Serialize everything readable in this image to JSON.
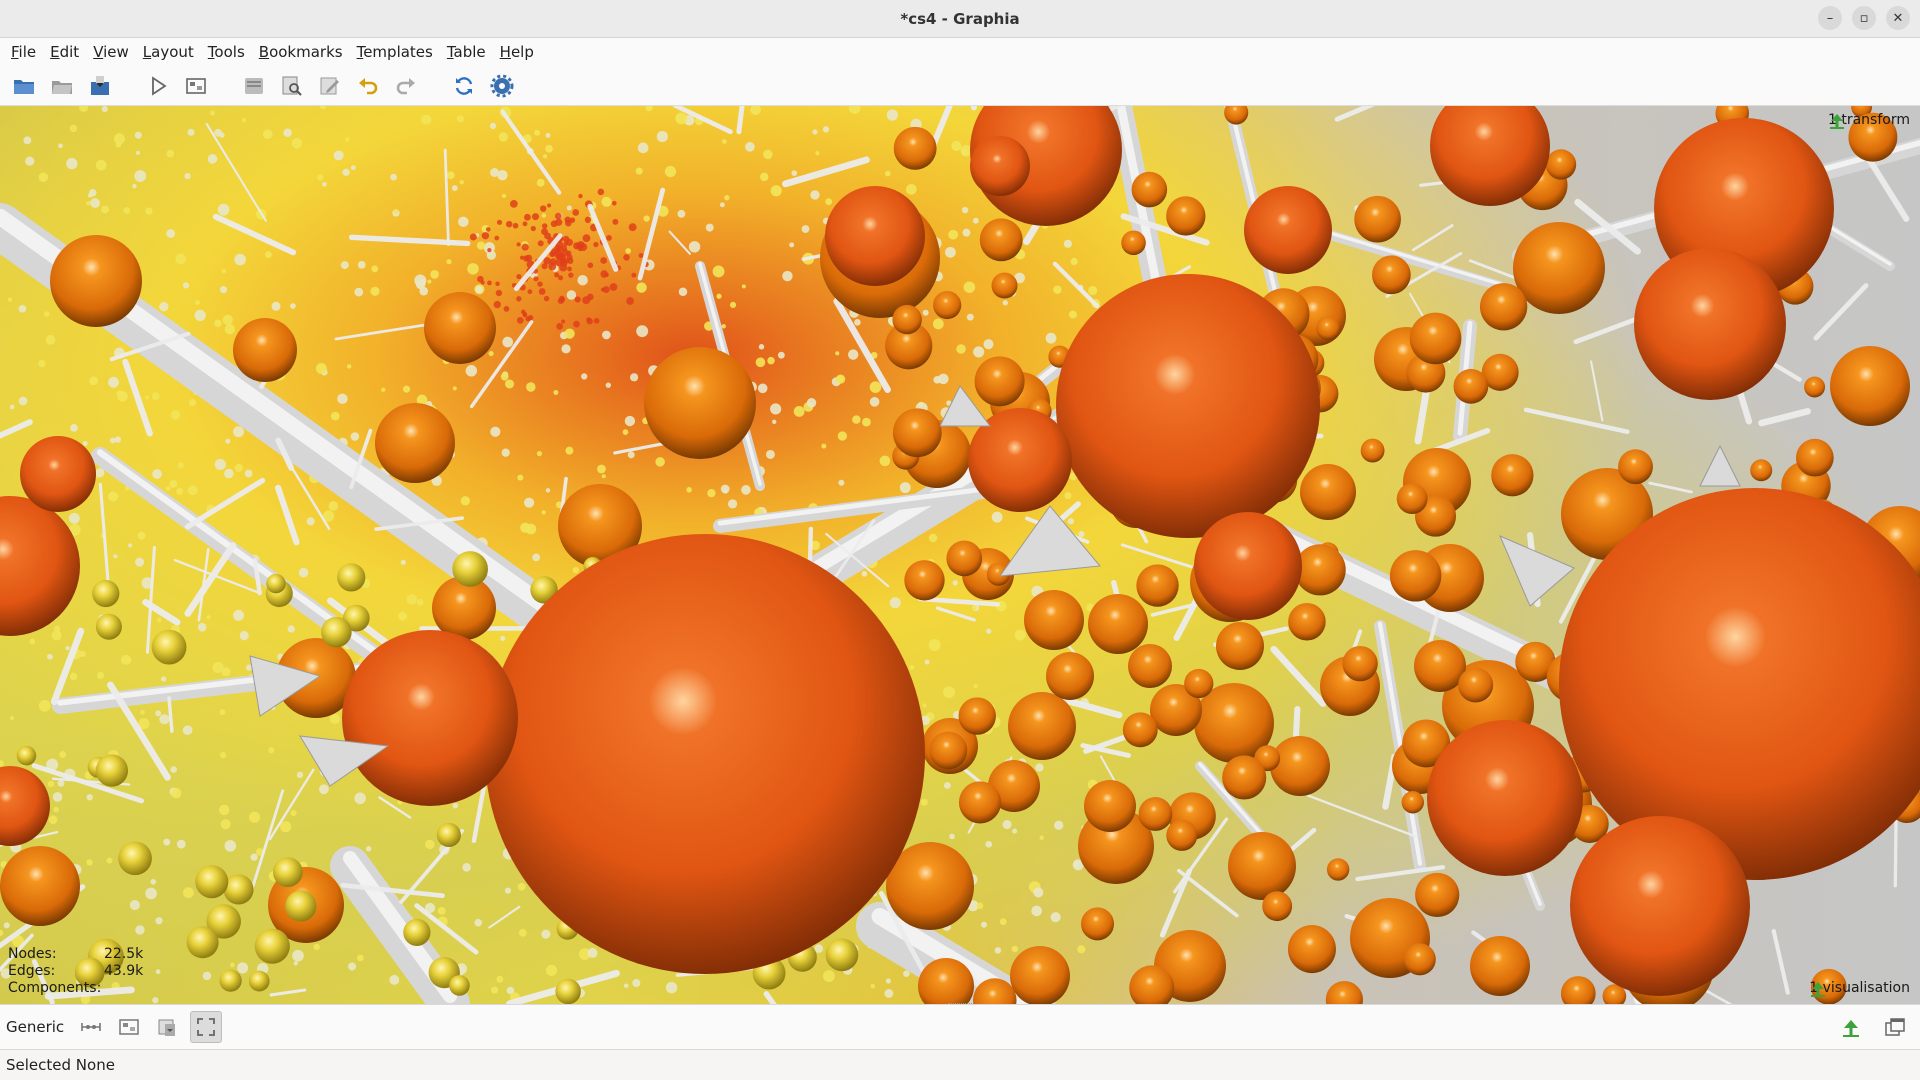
{
  "window": {
    "title": "*cs4 - Graphia",
    "controls": {
      "minimize": "–",
      "maximize": "▫",
      "close": "✕"
    }
  },
  "menu": [
    {
      "label": "File",
      "underline": "F",
      "rest": "ile"
    },
    {
      "label": "Edit",
      "underline": "E",
      "rest": "dit"
    },
    {
      "label": "View",
      "underline": "V",
      "rest": "iew"
    },
    {
      "label": "Layout",
      "underline": "L",
      "rest": "ayout"
    },
    {
      "label": "Tools",
      "underline": "T",
      "rest": "ools"
    },
    {
      "label": "Bookmarks",
      "underline": "B",
      "rest": "ookmarks"
    },
    {
      "label": "Templates",
      "underline": "T",
      "rest": "emplates"
    },
    {
      "label": "Table",
      "underline": "T",
      "rest": "able"
    },
    {
      "label": "Help",
      "underline": "H",
      "rest": "elp"
    }
  ],
  "toolbar": {
    "icons": [
      "open-file-icon",
      "open-in-tab-icon",
      "save-icon",
      "play-layout-icon",
      "overview-icon",
      "delete-icon",
      "find-icon",
      "edit-icon",
      "undo-icon",
      "redo-icon",
      "refresh-icon",
      "settings-icon"
    ]
  },
  "graph": {
    "transform_label": "1 transform",
    "visualisation_label": "1 visualisation",
    "stats": {
      "nodes_label": "Nodes:",
      "nodes_value": "22.5k",
      "edges_label": "Edges:",
      "edges_value": "43.9k",
      "components_label": "Components:",
      "components_value": ""
    },
    "colors": {
      "node_dark": "#c44708",
      "node_light": "#f48a3a",
      "edge": "#d8d8d8",
      "background": "#c8c8c8"
    }
  },
  "plugin_bar": {
    "plugin_name": "Generic",
    "icons": [
      "node-size-icon",
      "overview-mode-icon",
      "save-image-icon",
      "fullscreen-icon"
    ],
    "right_icons": [
      "collapse-panel-icon",
      "detach-window-icon"
    ]
  },
  "status": {
    "text": "Selected None"
  }
}
